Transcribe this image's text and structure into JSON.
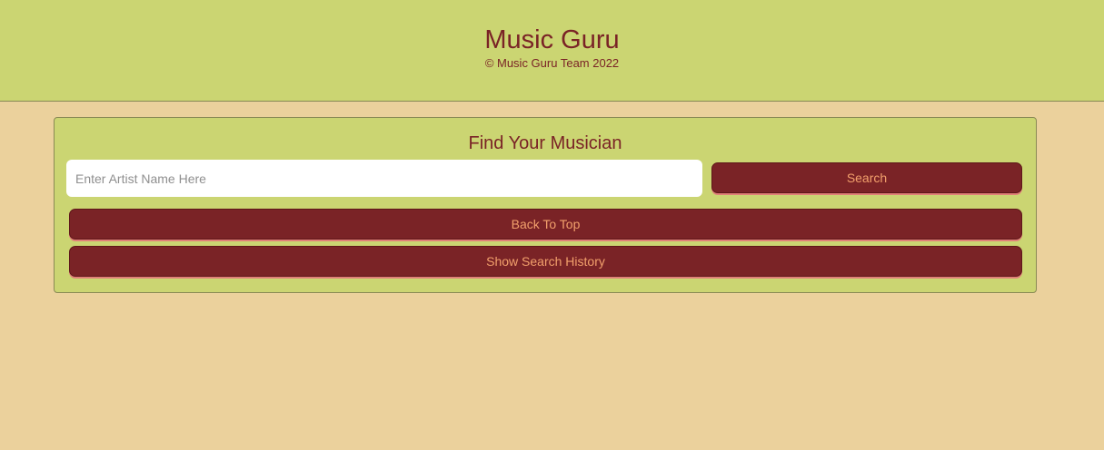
{
  "header": {
    "title": "Music Guru",
    "copyright": "© Music Guru Team 2022"
  },
  "search_panel": {
    "title": "Find Your Musician",
    "input": {
      "value": "",
      "placeholder": "Enter Artist Name Here"
    },
    "search_label": "Search",
    "back_to_top_label": "Back To Top",
    "history_label": "Show Search History"
  },
  "colors": {
    "page_background": "#ebd19c",
    "panel_background": "#cbd572",
    "button_background": "#7a2326",
    "button_text": "#f2a06c",
    "heading_text": "#7a2326"
  }
}
